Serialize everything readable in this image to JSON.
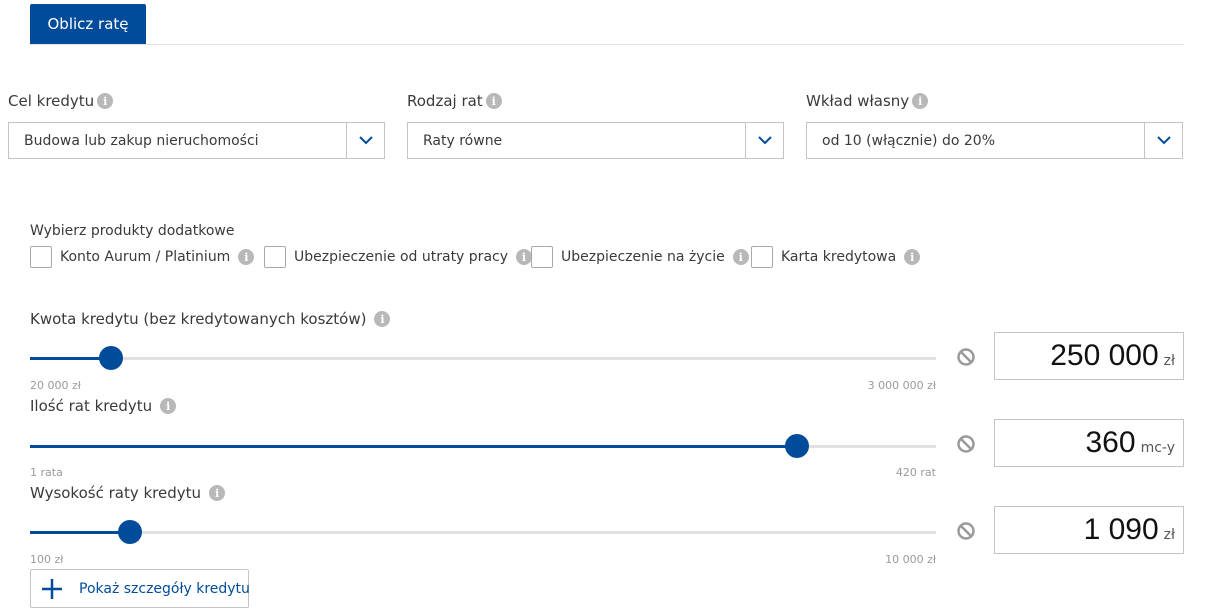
{
  "tab": {
    "label": "Oblicz ratę"
  },
  "selects": [
    {
      "label": "Cel kredytu",
      "value": "Budowa lub zakup nieruchomości"
    },
    {
      "label": "Rodzaj rat",
      "value": "Raty równe"
    },
    {
      "label": "Wkład własny",
      "value": "od 10 (włącznie) do 20%"
    }
  ],
  "addons": {
    "title": "Wybierz produkty dodatkowe",
    "items": [
      {
        "label": "Konto Aurum / Platinium",
        "checked": false
      },
      {
        "label": "Ubezpieczenie od utraty pracy",
        "checked": false
      },
      {
        "label": "Ubezpieczenie na życie",
        "checked": false
      },
      {
        "label": "Karta kredytowa",
        "checked": false
      }
    ]
  },
  "sliders": [
    {
      "label": "Kwota kredytu (bez kredytowanych kosztów)",
      "min_label": "20 000 zł",
      "max_label": "3 000 000 zł",
      "value": "250 000",
      "unit": "zł",
      "fraction": 0.089
    },
    {
      "label": "Ilość rat kredytu",
      "min_label": "1 rata",
      "max_label": "420 rat",
      "value": "360",
      "unit": "mc-y",
      "fraction": 0.847
    },
    {
      "label": "Wysokość raty kredytu",
      "min_label": "100 zł",
      "max_label": "10 000 zł",
      "value": "1 090",
      "unit": "zł",
      "fraction": 0.11
    }
  ],
  "details_button": {
    "label": "Pokaż szczegóły kredytu"
  },
  "colors": {
    "accent": "#004c9b",
    "info_icon": "#b8b8b8",
    "border": "#c4c4c4"
  },
  "icons": {
    "info": "info-icon",
    "dropdown": "chevron-down-icon",
    "reset": "ban-icon",
    "expand": "plus-icon"
  }
}
